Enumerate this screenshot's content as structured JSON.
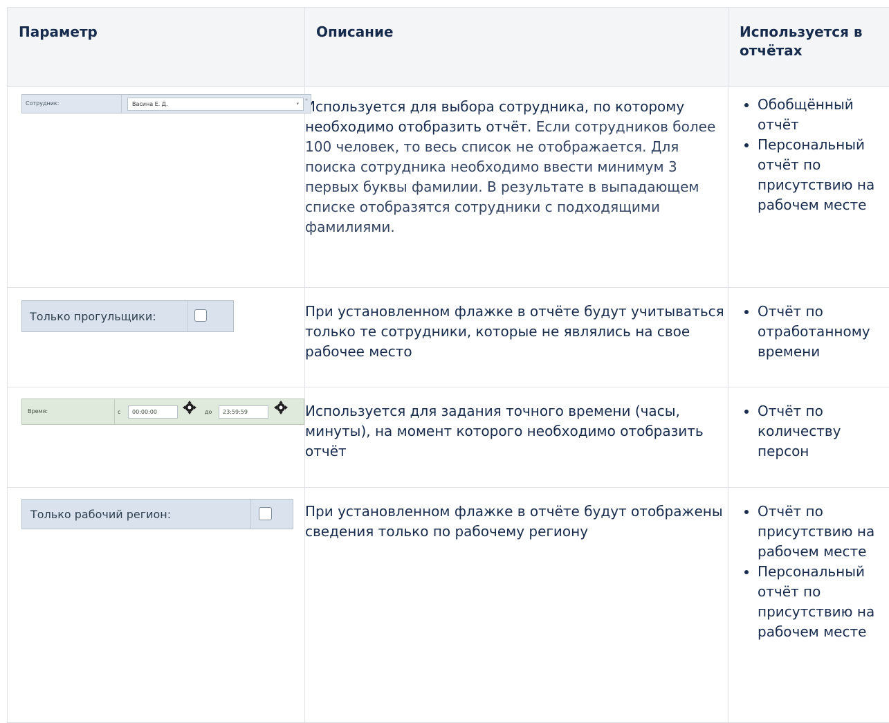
{
  "table": {
    "headers": {
      "param": "Параметр",
      "description": "Описание",
      "used_in": "Используется в отчётах"
    },
    "rows": [
      {
        "widget": {
          "label": "Сотрудник:",
          "value": "Васина Е. Д.",
          "arrow": "▾",
          "marker": "*"
        },
        "description": "Используется для выбора сотрудника, по которому необходимо отобразить отчёт.",
        "note": "Если сотрудников более 100 человек, то весь список не отображается. Для поиска сотрудника необходимо ввести минимум 3 первых буквы фамилии. В результате в выпадающем списке отобразятся сотрудники с подходящими фамилиями.",
        "reports": [
          "Обобщённый отчёт",
          "Персональный отчёт по присутствию на рабочем месте"
        ]
      },
      {
        "widget": {
          "label": "Только прогульщики:",
          "checked": false
        },
        "description": "При установленном флажке в отчёте будут учитываться только те сотрудники, которые не являлись на свое рабочее место",
        "reports": [
          "Отчёт по отработанному времени"
        ]
      },
      {
        "widget": {
          "label": "Время:",
          "from_label": "с",
          "from_value": "00:00:00",
          "to_label": "до",
          "to_value": "23:59:59"
        },
        "description": "Используется для задания точного времени (часы, минуты), на момент которого необходимо отобразить отчёт",
        "reports": [
          "Отчёт по количеству персон"
        ]
      },
      {
        "widget": {
          "label": "Только рабочий регион:",
          "checked": false
        },
        "description": "При установленном флажке в отчёте будут отображены сведения только по рабочему региону",
        "reports": [
          "Отчёт по присутствию на рабочем месте",
          "Персональный отчёт по присутствию на рабочем месте"
        ]
      }
    ]
  },
  "colors": {
    "header_bg": "#f4f5f7",
    "border": "#dfe1e6",
    "text": "#172b4d",
    "note_text": "#344563"
  }
}
